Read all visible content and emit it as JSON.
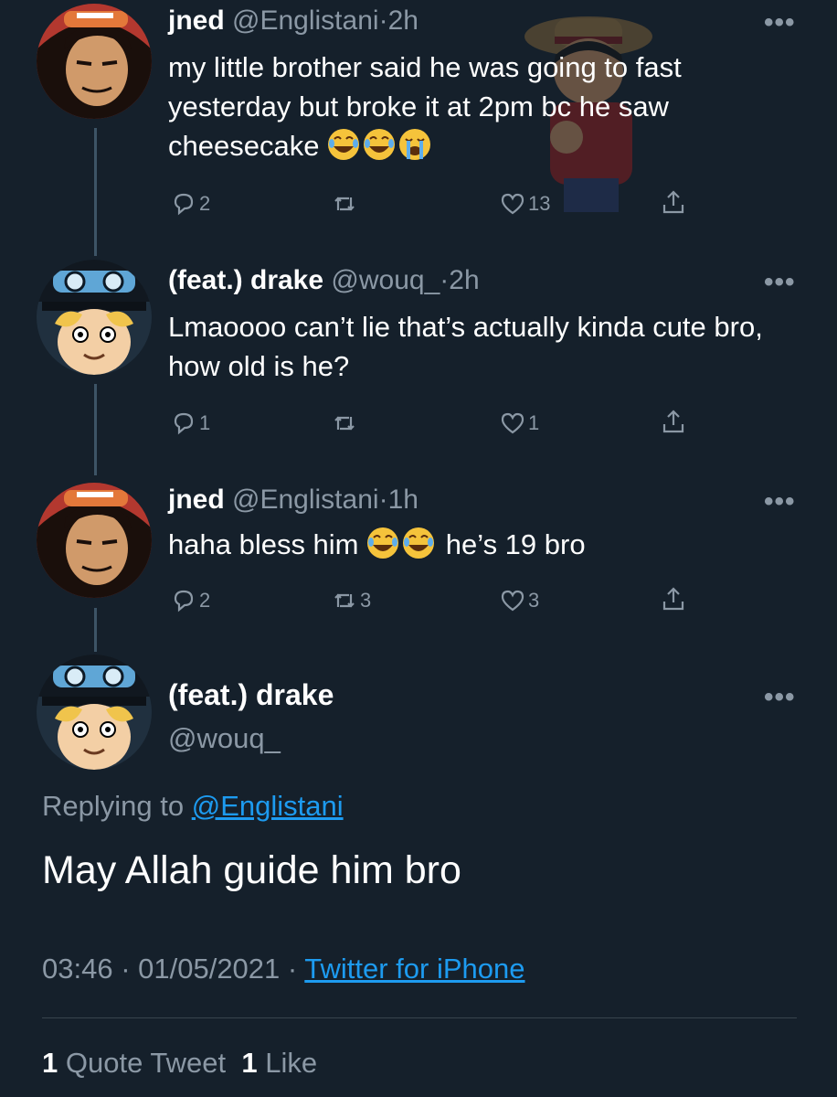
{
  "thread": [
    {
      "name": "jned",
      "handle": "@Englistani",
      "time": "2h",
      "dot": "·",
      "text": "my little brother said he was going to fast yesterday but broke it at 2pm bc he saw cheesecake",
      "emoji": [
        "joy-emoji",
        "joy-emoji",
        "sob-emoji"
      ],
      "replies": "2",
      "retweets": "",
      "likes": "13"
    },
    {
      "name": "(feat.) drake",
      "handle": "@wouq_",
      "time": "2h",
      "dot": "·",
      "text": "Lmaoooo can’t lie that’s actually kinda cute bro, how old is he?",
      "replies": "1",
      "retweets": "",
      "likes": "1"
    },
    {
      "name": "jned",
      "handle": "@Englistani",
      "time": "1h",
      "dot": "·",
      "text_before": "haha bless him",
      "text_after": "he’s 19 bro",
      "emoji": [
        "joy-emoji",
        "joy-emoji"
      ],
      "replies": "2",
      "retweets": "3",
      "likes": "3"
    }
  ],
  "main": {
    "name": "(feat.) drake",
    "handle": "@wouq_",
    "replying_prefix": "Replying to",
    "replying_to": "@Englistani",
    "text": "May Allah guide him bro",
    "time": "03:46 · 01/05/2021 ·",
    "source": "Twitter for iPhone",
    "quote_count": "1",
    "quote_label": "Quote Tweet",
    "like_count": "1",
    "like_label": "Like"
  },
  "more_label": "•••",
  "colors": {
    "background": "#15202b",
    "secondary_text": "#8b98a5",
    "link": "#1d9bf0",
    "thread_line": "#3d5466"
  }
}
